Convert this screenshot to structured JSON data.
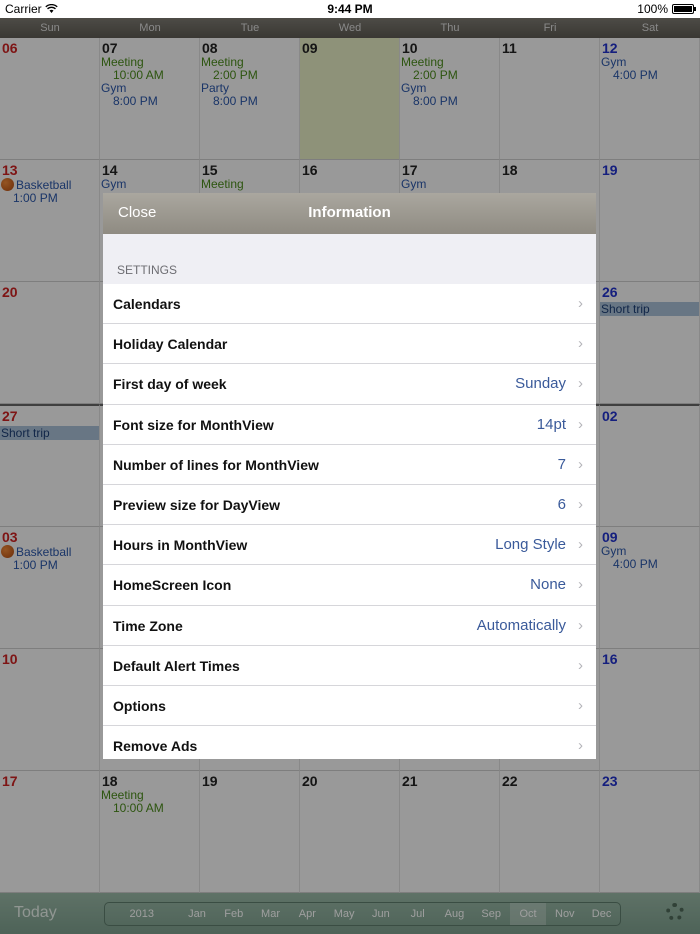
{
  "status_bar": {
    "carrier": "Carrier",
    "time": "9:44 PM",
    "battery": "100%"
  },
  "weekdays": [
    "Sun",
    "Mon",
    "Tue",
    "Wed",
    "Thu",
    "Fri",
    "Sat"
  ],
  "calendar": {
    "weeks": [
      [
        {
          "day": "06"
        },
        {
          "day": "07",
          "events": [
            {
              "title": "Meeting",
              "time": "10:00 AM",
              "color": "green"
            },
            {
              "title": "Gym",
              "time": "8:00 PM",
              "color": "blue"
            }
          ]
        },
        {
          "day": "08",
          "events": [
            {
              "title": "Meeting",
              "time": "2:00 PM",
              "color": "green"
            },
            {
              "title": "Party",
              "time": "8:00 PM",
              "color": "blue"
            }
          ]
        },
        {
          "day": "09",
          "today": true
        },
        {
          "day": "10",
          "events": [
            {
              "title": "Meeting",
              "time": "2:00 PM",
              "color": "green"
            },
            {
              "title": "Gym",
              "time": "8:00 PM",
              "color": "blue"
            }
          ]
        },
        {
          "day": "11"
        },
        {
          "day": "12",
          "events": [
            {
              "title": "Gym",
              "time": "4:00 PM",
              "color": "blue"
            }
          ]
        }
      ],
      [
        {
          "day": "13",
          "events": [
            {
              "title": "Basketball",
              "time": "1:00 PM",
              "color": "blue",
              "icon": "basketball-icon"
            }
          ]
        },
        {
          "day": "14",
          "events": [
            {
              "title": "Gym",
              "color": "blue"
            }
          ]
        },
        {
          "day": "15",
          "events": [
            {
              "title": "Meeting",
              "color": "green"
            }
          ]
        },
        {
          "day": "16"
        },
        {
          "day": "17",
          "events": [
            {
              "title": "Gym",
              "color": "blue"
            }
          ]
        },
        {
          "day": "18"
        },
        {
          "day": "19"
        }
      ],
      [
        {
          "day": "20"
        },
        {
          "day": ""
        },
        {
          "day": ""
        },
        {
          "day": ""
        },
        {
          "day": ""
        },
        {
          "day": ""
        },
        {
          "day": "26",
          "bar": "Short trip"
        }
      ],
      [
        {
          "day": "27",
          "bar": "Short trip",
          "thick": true
        },
        {
          "day": "",
          "thick": true
        },
        {
          "day": "",
          "thick": true
        },
        {
          "day": "",
          "thick": true
        },
        {
          "day": "",
          "thick": true
        },
        {
          "day": "",
          "thick": true
        },
        {
          "day": "02",
          "thick": true
        }
      ],
      [
        {
          "day": "03",
          "events": [
            {
              "title": "Basketball",
              "time": "1:00 PM",
              "color": "blue",
              "icon": "basketball-icon"
            }
          ]
        },
        {
          "day": ""
        },
        {
          "day": ""
        },
        {
          "day": ""
        },
        {
          "day": ""
        },
        {
          "day": ""
        },
        {
          "day": "09",
          "events": [
            {
              "title": "Gym",
              "time": "4:00 PM",
              "color": "blue"
            }
          ]
        }
      ],
      [
        {
          "day": "10"
        },
        {
          "day": ""
        },
        {
          "day": ""
        },
        {
          "day": ""
        },
        {
          "day": ""
        },
        {
          "day": ""
        },
        {
          "day": "16"
        }
      ],
      [
        {
          "day": "17"
        },
        {
          "day": "18",
          "events": [
            {
              "title": "Meeting",
              "time": "10:00 AM",
              "color": "green"
            }
          ]
        },
        {
          "day": "19"
        },
        {
          "day": "20"
        },
        {
          "day": "21"
        },
        {
          "day": "22"
        },
        {
          "day": "23"
        }
      ]
    ]
  },
  "toolbar": {
    "today_label": "Today",
    "year": "2013",
    "months": [
      "Jan",
      "Feb",
      "Mar",
      "Apr",
      "May",
      "Jun",
      "Jul",
      "Aug",
      "Sep",
      "Oct",
      "Nov",
      "Dec"
    ],
    "selected_month": "Oct"
  },
  "modal": {
    "close_label": "Close",
    "title": "Information",
    "section": "SETTINGS",
    "rows": [
      {
        "label": "Calendars",
        "value": ""
      },
      {
        "label": "Holiday Calendar",
        "value": ""
      },
      {
        "label": "First day of week",
        "value": "Sunday"
      },
      {
        "label": "Font size for MonthView",
        "value": "14pt"
      },
      {
        "label": "Number of lines for MonthView",
        "value": "7"
      },
      {
        "label": "Preview size for DayView",
        "value": "6"
      },
      {
        "label": "Hours in MonthView",
        "value": "Long Style"
      },
      {
        "label": "HomeScreen Icon",
        "value": "None"
      },
      {
        "label": "Time Zone",
        "value": "Automatically"
      },
      {
        "label": "Default Alert Times",
        "value": ""
      },
      {
        "label": "Options",
        "value": ""
      },
      {
        "label": "Remove Ads",
        "value": ""
      }
    ]
  },
  "colors": {
    "today_bg": "#e6ecc4",
    "sunday": "#cc2222",
    "saturday": "#2233cc",
    "event_green": "#4a8a1a",
    "event_blue": "#2a56a8",
    "value_blue": "#3a5a9a"
  }
}
